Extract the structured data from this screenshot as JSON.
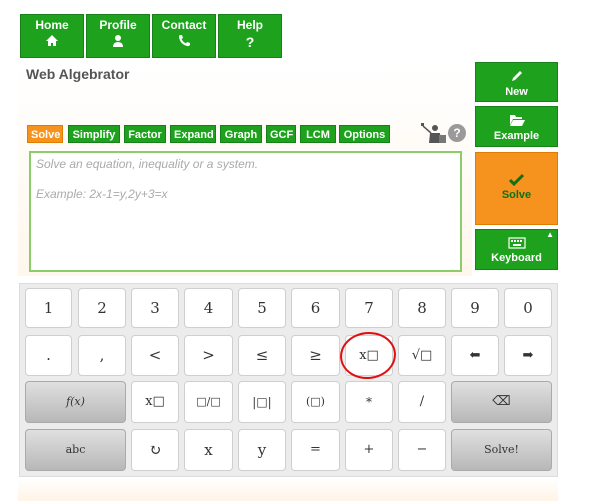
{
  "nav": [
    {
      "label": "Home",
      "icon": "home-icon"
    },
    {
      "label": "Profile",
      "icon": "user-icon"
    },
    {
      "label": "Contact",
      "icon": "phone-icon"
    },
    {
      "label": "Help",
      "icon": "question-icon"
    }
  ],
  "app_title": "Web Algebrator",
  "tabs": [
    "Solve",
    "Simplify",
    "Factor",
    "Expand",
    "Graph",
    "GCF",
    "LCM",
    "Options"
  ],
  "active_tab": "Solve",
  "help_label": "?",
  "input": {
    "placeholder": "Solve an equation, inequality or a system.",
    "example": "Example: 2x-1=y,2y+3=x"
  },
  "side": {
    "new": "New",
    "example": "Example",
    "solve": "Solve",
    "keyboard": "Keyboard"
  },
  "keys": {
    "row1": [
      "1",
      "2",
      "3",
      "4",
      "5",
      "6",
      "7",
      "8",
      "9",
      "0"
    ],
    "row2": [
      ".",
      ",",
      "<",
      ">",
      "≤",
      "≥",
      "x□",
      "√□",
      "⬅",
      "➡"
    ],
    "row3": [
      "f(x)",
      "x□",
      "□/□",
      "|□|",
      "(□)",
      "*",
      "/",
      "⌫"
    ],
    "row4": [
      "abc",
      "↻",
      "x",
      "y",
      "=",
      "+",
      "−",
      "Solve!"
    ]
  },
  "colors": {
    "green": "#1ea21e",
    "orange": "#f5931e",
    "annotation": "#e01010"
  }
}
